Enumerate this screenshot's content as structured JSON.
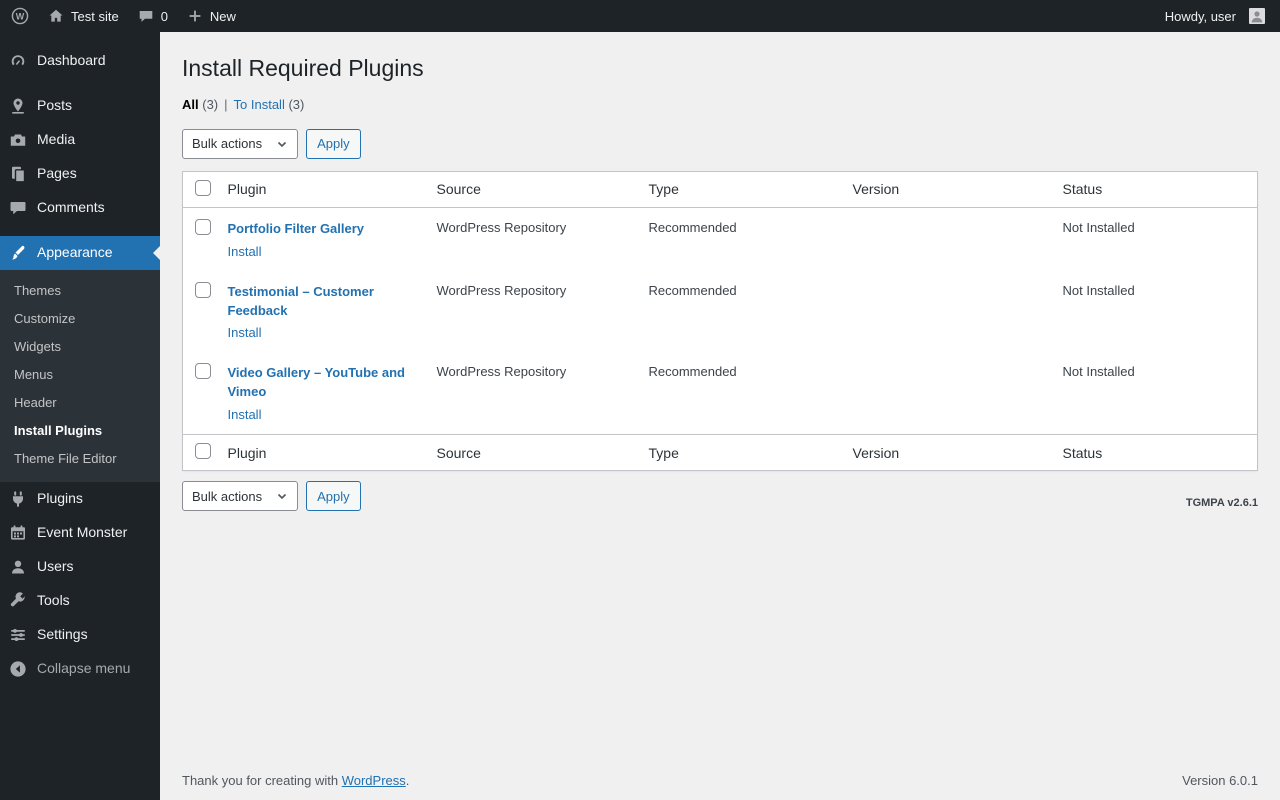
{
  "colors": {
    "accent": "#2271b1",
    "admin_bar_bg": "#1d2327",
    "sidebar_bg": "#1d2327",
    "submenu_bg": "#2c3338",
    "content_bg": "#f0f0f1",
    "link": "#2271b1"
  },
  "admin_bar": {
    "site_name": "Test site",
    "comments_count": "0",
    "new_label": "New",
    "howdy_text": "Howdy, user"
  },
  "sidebar": {
    "items": [
      "Dashboard",
      "Posts",
      "Media",
      "Pages",
      "Comments",
      "Appearance",
      "Plugins",
      "Event Monster",
      "Users",
      "Tools",
      "Settings",
      "Collapse menu"
    ],
    "appearance_submenu": [
      "Themes",
      "Customize",
      "Widgets",
      "Menus",
      "Header",
      "Install Plugins",
      "Theme File Editor"
    ],
    "current_submenu": "Install Plugins"
  },
  "main": {
    "page_title": "Install Required Plugins",
    "filters": [
      {
        "label": "All",
        "count": "(3)"
      },
      {
        "label": "To Install",
        "count": "(3)"
      }
    ],
    "filter_separator": "|",
    "bulk_actions": {
      "selected": "Bulk actions"
    },
    "apply_label": "Apply",
    "table": {
      "headers": {
        "plugin": "Plugin",
        "source": "Source",
        "type": "Type",
        "version": "Version",
        "status": "Status"
      },
      "rows": [
        {
          "name": "Portfolio Filter Gallery",
          "action": "Install",
          "source": "WordPress Repository",
          "type": "Recommended",
          "version": "",
          "status": "Not Installed"
        },
        {
          "name": "Testimonial – Customer Feedback",
          "action": "Install",
          "source": "WordPress Repository",
          "type": "Recommended",
          "version": "",
          "status": "Not Installed"
        },
        {
          "name": "Video Gallery – YouTube and Vimeo",
          "action": "Install",
          "source": "WordPress Repository",
          "type": "Recommended",
          "version": "",
          "status": "Not Installed"
        }
      ]
    },
    "tgmpa_version": "TGMPA v2.6.1"
  },
  "footer": {
    "credit_prefix": "Thank you for creating with ",
    "credit_link": "WordPress",
    "credit_suffix": ".",
    "version": "Version 6.0.1"
  }
}
